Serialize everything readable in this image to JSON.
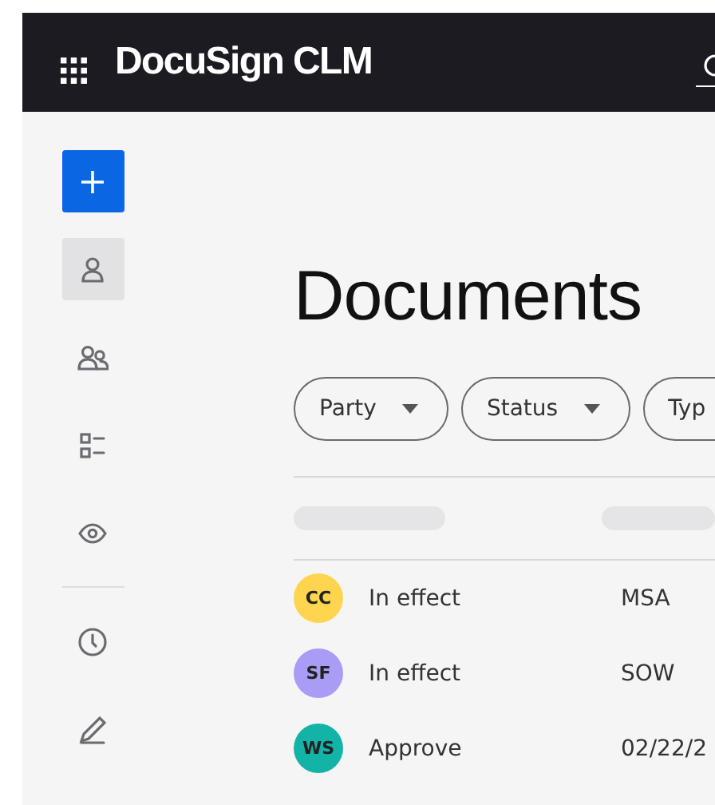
{
  "header": {
    "title": "DocuSign CLM"
  },
  "sidebar": {
    "items": [
      {
        "kind": "add",
        "selected": false
      },
      {
        "kind": "person",
        "selected": true
      },
      {
        "kind": "people",
        "selected": false
      },
      {
        "kind": "checklist",
        "selected": false
      },
      {
        "kind": "eye",
        "selected": false
      },
      {
        "kind": "divider",
        "selected": false
      },
      {
        "kind": "clock",
        "selected": false
      },
      {
        "kind": "pen",
        "selected": false
      }
    ]
  },
  "page_title": "Documents",
  "filters": [
    {
      "label": "Party"
    },
    {
      "label": "Status"
    },
    {
      "label": "Typ"
    }
  ],
  "table": {
    "rows": [
      {
        "initials": "CC",
        "color": "#ffd54f",
        "column_1": "In effect",
        "column_2": "MSA"
      },
      {
        "initials": "SF",
        "color": "#a99cf7",
        "column_1": "In effect",
        "column_2": "SOW"
      },
      {
        "initials": "WS",
        "color": "#14b3a8",
        "column_1": "Approve",
        "column_2": "02/22/2"
      }
    ]
  }
}
